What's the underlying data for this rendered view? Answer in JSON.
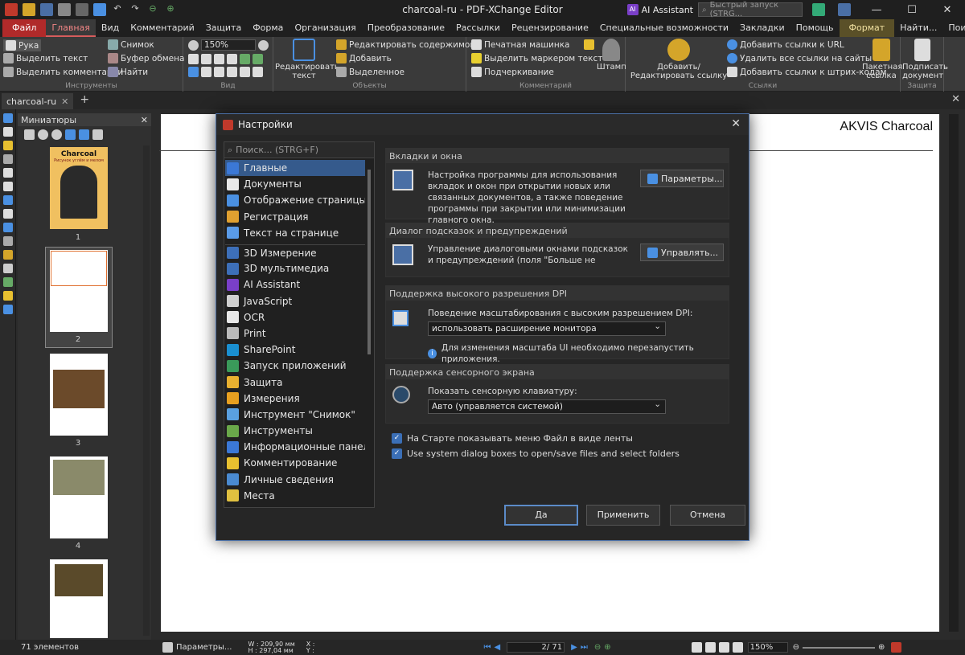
{
  "window": {
    "title": "charcoal-ru - PDF-XChange Editor",
    "ai_assistant": "AI Assistant",
    "quick_search_placeholder": "Быстрый запуск (STRG...",
    "minimize": "—",
    "maximize": "☐",
    "close": "✕"
  },
  "menu": {
    "items": [
      "Файл",
      "Главная",
      "Вид",
      "Комментарий",
      "Защита",
      "Форма",
      "Организация",
      "Преобразование",
      "Рассылки",
      "Рецензирование",
      "Специальные возможности",
      "Закладки",
      "Помощь",
      "Формат"
    ],
    "find": "Найти...",
    "search": "Поиск..."
  },
  "ribbon": {
    "tools": {
      "hand": "Рука",
      "select_text": "Выделить текст",
      "select_comments": "Выделить комментарии",
      "snapshot": "Снимок",
      "clipboard": "Буфер обмена",
      "find": "Найти",
      "label": "Инструменты"
    },
    "view": {
      "zoom": "150%",
      "label": "Вид"
    },
    "objects": {
      "edit_text": "Редактировать текст",
      "edit_content": "Редактировать содержимого",
      "add": "Добавить",
      "selected": "Выделенное",
      "label": "Объекты"
    },
    "comment": {
      "typewriter": "Печатная машинка",
      "highlight": "Выделить маркером текст",
      "underline": "Подчеркивание",
      "stamp": "Штамп",
      "label": "Комментарий"
    },
    "links": {
      "add_edit": "Добавить/Редактировать ссылку",
      "add_url": "Добавить ссылки к URL",
      "remove_web": "Удалить все ссылки на сайты",
      "add_barcode": "Добавить ссылки к штрих-кодам",
      "batch": "Пакетная ссылка",
      "label": "Ссылки"
    },
    "protect": {
      "sign": "Подписать документ",
      "label": "Защита"
    }
  },
  "tabs": {
    "doc": "charcoal-ru",
    "add": "+"
  },
  "thumbnails": {
    "title": "Миниатюры",
    "count": "71 элементов",
    "pages": [
      "1",
      "2",
      "3",
      "4"
    ],
    "cover_title": "Charcoal",
    "cover_subtitle": "Рисунок углём и мелом"
  },
  "page": {
    "heading": "AKVIS Charcoal"
  },
  "status": {
    "params": "Параметры...",
    "w": "W : 209,90 мм",
    "h": "H : 297,04 мм",
    "x": "X :",
    "y": "Y :",
    "page_current": "2",
    "page_total": "/ 71",
    "zoom": "150%"
  },
  "dialog": {
    "title": "Настройки",
    "search_placeholder": "Поиск... (STRG+F)",
    "nav": [
      {
        "label": "Главные",
        "color": "#3b78d6"
      },
      {
        "label": "Документы",
        "color": "#e8e8e8"
      },
      {
        "label": "Отображение страницы",
        "color": "#4a90e2"
      },
      {
        "label": "Регистрация",
        "color": "#e0a030"
      },
      {
        "label": "Текст на странице",
        "color": "#5a9be8"
      },
      {
        "label": "3D Измерение",
        "color": "#3d6fb8"
      },
      {
        "label": "3D мультимедиа",
        "color": "#3d6fb8"
      },
      {
        "label": "AI Assistant",
        "color": "#7a3fc8"
      },
      {
        "label": "JavaScript",
        "color": "#d0d0d0"
      },
      {
        "label": "OCR",
        "color": "#e8e8e8"
      },
      {
        "label": "Print",
        "color": "#bbbbbb"
      },
      {
        "label": "SharePoint",
        "color": "#1a8fd0"
      },
      {
        "label": "Запуск приложений",
        "color": "#3a9a5a"
      },
      {
        "label": "Защита",
        "color": "#e8b030"
      },
      {
        "label": "Измерения",
        "color": "#e8a020"
      },
      {
        "label": "Инструмент \"Снимок\"",
        "color": "#5aa0e0"
      },
      {
        "label": "Инструменты",
        "color": "#6aa84a"
      },
      {
        "label": "Информационные панели документа",
        "color": "#3b78d6"
      },
      {
        "label": "Комментирование",
        "color": "#e8c030"
      },
      {
        "label": "Личные сведения",
        "color": "#4a8ad0"
      },
      {
        "label": "Места",
        "color": "#e0c040"
      }
    ],
    "sections": {
      "tabs": {
        "head": "Вкладки и окна",
        "text": "Настройка программы для использования вкладок и окон при открытии новых или связанных документов, а также поведение программы при закрытии или минимизации главного окна.",
        "button": "Параметры..."
      },
      "hints": {
        "head": "Диалог подсказок и предупреждений",
        "text": "Управление диалоговыми окнами подсказок и предупреждений (поля \"Больше не показывать это...",
        "button": "Управлять..."
      },
      "dpi": {
        "head": "Поддержка высокого разрешения DPI",
        "label": "Поведение масштабирования с высоким разрешением DPI:",
        "value": "использовать расширение монитора",
        "note": "Для изменения масштаба UI необходимо перезапустить приложения."
      },
      "touch": {
        "head": "Поддержка сенсорного экрана",
        "label": "Показать сенсорную клавиатуру:",
        "value": "Авто (управляется системой)"
      }
    },
    "checkboxes": [
      "На Старте показывать меню Файл в виде ленты",
      "Use system dialog boxes to open/save files and select folders"
    ],
    "buttons": {
      "ok": "Да",
      "apply": "Применить",
      "cancel": "Отмена"
    }
  }
}
